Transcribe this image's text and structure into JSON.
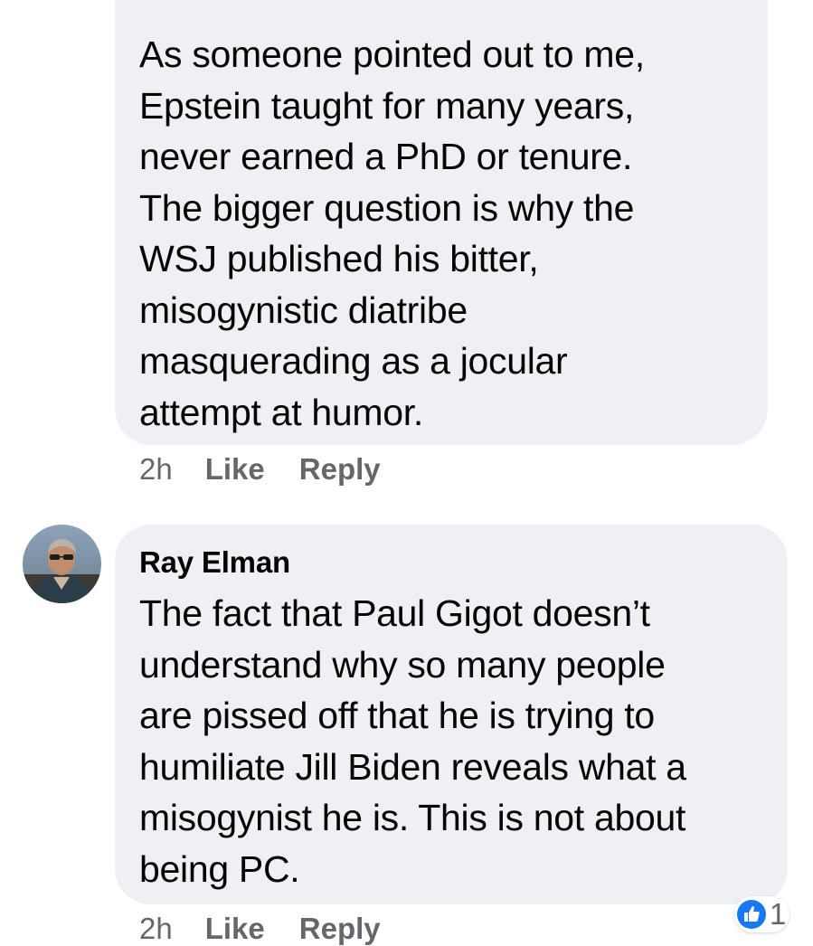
{
  "comments": [
    {
      "author": "",
      "text": "As someone pointed out to me,\nEpstein taught for many years,\nnever earned a PhD or tenure.\nThe bigger question is why the\nWSJ published his bitter,\nmisogynistic diatribe\nmasquerading as a jocular\nattempt at humor.",
      "time": "2h",
      "like_label": "Like",
      "reply_label": "Reply"
    },
    {
      "author": "Ray Elman",
      "text": "The fact that Paul Gigot doesn’t\nunderstand why so many people\nare pissed off that he is trying to\nhumiliate Jill Biden reveals what a\nmisogynist he is. This is not about\nbeing PC.",
      "time": "2h",
      "like_label": "Like",
      "reply_label": "Reply",
      "reactions": {
        "icon": "thumbs-up-icon",
        "count": "1"
      }
    }
  ],
  "colors": {
    "bubble_bg": "#eff0f3",
    "text": "#050505",
    "secondary_text": "#65676b",
    "like_blue": "#1877f2"
  }
}
